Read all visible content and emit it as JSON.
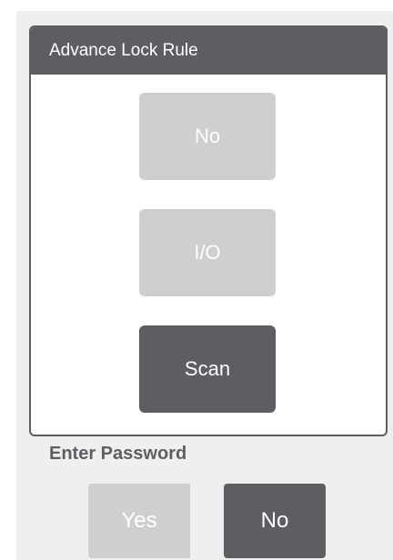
{
  "advance_lock_rule": {
    "title": "Advance Lock Rule",
    "options": [
      {
        "label": "No",
        "selected": false
      },
      {
        "label": "I/O",
        "selected": false
      },
      {
        "label": "Scan",
        "selected": true
      }
    ]
  },
  "enter_password": {
    "label": "Enter Password",
    "yes_label": "Yes",
    "no_label": "No",
    "selected": "No"
  },
  "colors": {
    "accent": "#5d5e61",
    "inactive": "#cfcfcf",
    "background": "#efefef"
  }
}
